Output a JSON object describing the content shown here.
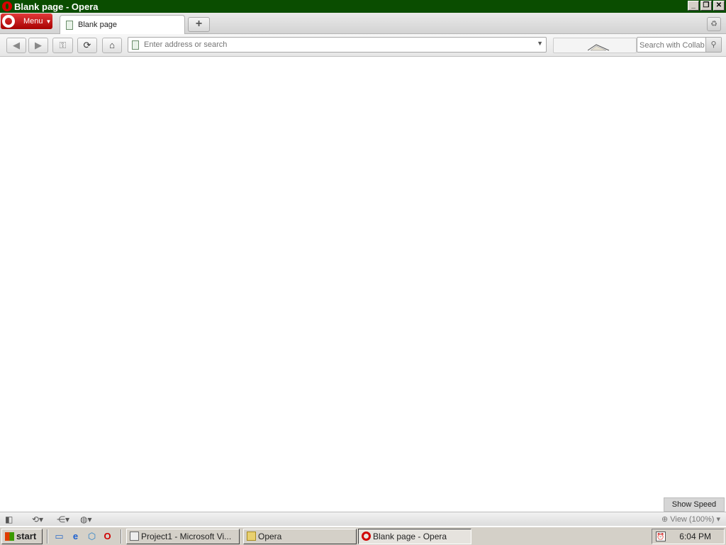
{
  "window": {
    "title": "Blank page - Opera",
    "controls": [
      "minimize",
      "restore",
      "close"
    ]
  },
  "tabstrip": {
    "menu_label": "Menu",
    "tabs": [
      {
        "label": "Blank page",
        "active": true
      }
    ],
    "new_tab_label": "+"
  },
  "toolbar": {
    "address_placeholder": "Enter address or search",
    "search_placeholder": "Search with Collab'"
  },
  "statusbar": {
    "speed_dial_label": "Show Speed Dial",
    "zoom_label": "View (100%)"
  },
  "taskbar": {
    "start_label": "start",
    "tasks": [
      {
        "label": "Project1 - Microsoft Vi..."
      },
      {
        "label": "Opera"
      },
      {
        "label": "Blank page - Opera",
        "active": true
      }
    ],
    "clock": "6:04 PM"
  },
  "colors": {
    "titlebar": "#0a4d00",
    "menu_button": "#c00000",
    "taskbar": "#d4d0c8"
  }
}
